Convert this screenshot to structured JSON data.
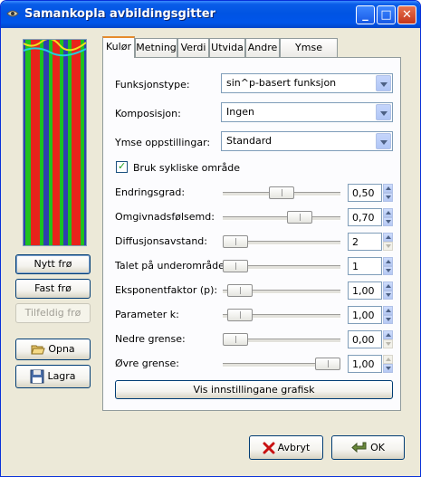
{
  "window": {
    "title": "Samankopla avbildingsgitter",
    "min_label": "_",
    "max_label": "□",
    "close_label": "✕"
  },
  "left": {
    "new_seed": "Nytt frø",
    "fixed_seed": "Fast frø",
    "random_seed": "Tilfeldig frø",
    "open": "Opna",
    "save": "Lagra"
  },
  "tabs": [
    "Kulør",
    "Metning",
    "Verdi",
    "Utvida",
    "Andre",
    "Ymse innst."
  ],
  "colour": {
    "function_type_label": "Funksjonstype:",
    "function_type_value": "sin^p-basert funksjon",
    "composition_label": "Komposisjon:",
    "composition_value": "Ingen",
    "misc_label": "Ymse oppstillingar:",
    "misc_value": "Standard",
    "cyclic_label": "Bruk sykliske område",
    "cyclic_checked": true,
    "sliders": [
      {
        "label": "Endringsgrad:",
        "value": "0,50",
        "fraction": 0.5,
        "up_enabled": true,
        "down_enabled": true
      },
      {
        "label": "Omgivnadsfølsemd:",
        "value": "0,70",
        "fraction": 0.7,
        "up_enabled": true,
        "down_enabled": true
      },
      {
        "label": "Diffusjonsavstand:",
        "value": "2",
        "fraction": 0.0,
        "up_enabled": true,
        "down_enabled": false
      },
      {
        "label": "Talet på underområde:",
        "value": "1",
        "fraction": 0.0,
        "up_enabled": true,
        "down_enabled": true
      },
      {
        "label": "Eksponentfaktor (p):",
        "value": "1,00",
        "fraction": 0.05,
        "up_enabled": true,
        "down_enabled": true
      },
      {
        "label": "Parameter k:",
        "value": "1,00",
        "fraction": 0.05,
        "up_enabled": true,
        "down_enabled": true
      },
      {
        "label": "Nedre grense:",
        "value": "0,00",
        "fraction": 0.0,
        "up_enabled": true,
        "down_enabled": false
      },
      {
        "label": "Øvre grense:",
        "value": "1,00",
        "fraction": 1.0,
        "up_enabled": false,
        "down_enabled": true
      }
    ],
    "show_graph": "Vis innstillingane grafisk"
  },
  "dialog": {
    "cancel": "Avbryt",
    "ok": "OK"
  },
  "colors": {
    "title_blue": "#0054e3",
    "preview_red": "#e8231b",
    "preview_green": "#1fc020",
    "preview_blue": "#2f3fb0",
    "tab_accent": "#e68b2c"
  },
  "icons": [
    "window-icon",
    "folder-open-icon",
    "floppy-save-icon",
    "cancel-x-icon",
    "ok-arrow-icon"
  ]
}
